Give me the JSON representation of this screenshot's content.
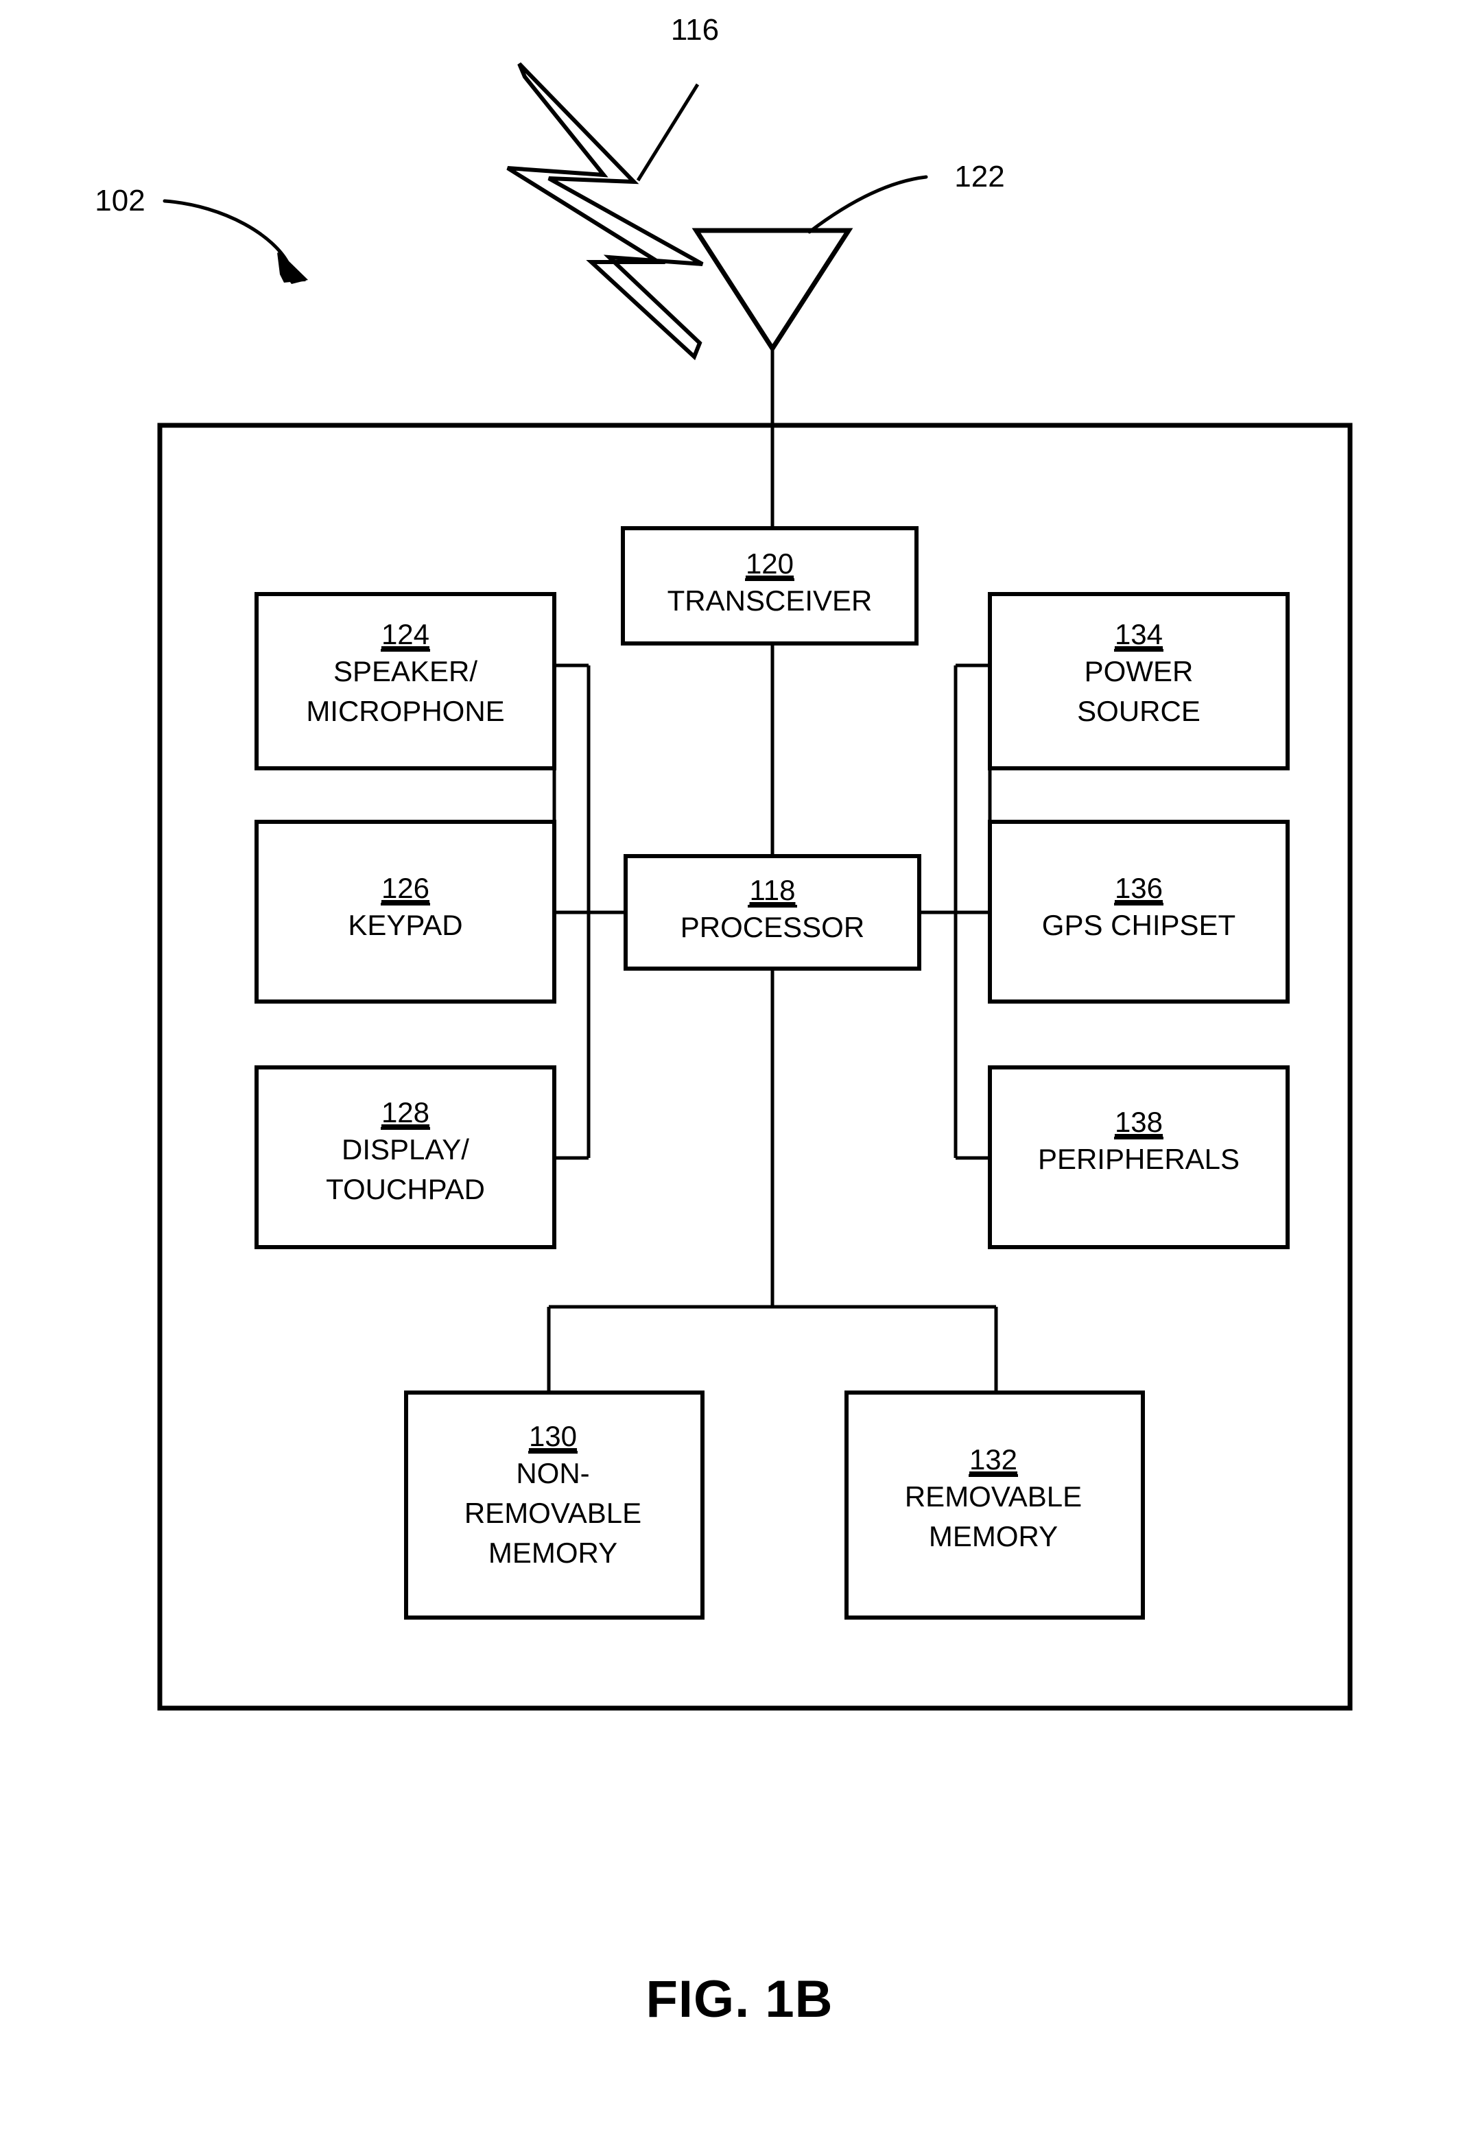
{
  "figure": {
    "caption": "FIG. 1B",
    "device_ref": "102",
    "air_interface_ref": "116",
    "antenna_ref": "122"
  },
  "blocks": {
    "transceiver": {
      "ref": "120",
      "lines": [
        "TRANSCEIVER"
      ]
    },
    "speaker_mic": {
      "ref": "124",
      "lines": [
        "SPEAKER/",
        "MICROPHONE"
      ]
    },
    "keypad": {
      "ref": "126",
      "lines": [
        "KEYPAD"
      ]
    },
    "display": {
      "ref": "128",
      "lines": [
        "DISPLAY/",
        "TOUCHPAD"
      ]
    },
    "processor": {
      "ref": "118",
      "lines": [
        "PROCESSOR"
      ]
    },
    "power_source": {
      "ref": "134",
      "lines": [
        "POWER",
        "SOURCE"
      ]
    },
    "gps_chipset": {
      "ref": "136",
      "lines": [
        "GPS CHIPSET"
      ]
    },
    "peripherals": {
      "ref": "138",
      "lines": [
        "PERIPHERALS"
      ]
    },
    "non_removable_memory": {
      "ref": "130",
      "lines": [
        "NON-",
        "REMOVABLE",
        "MEMORY"
      ]
    },
    "removable_memory": {
      "ref": "132",
      "lines": [
        "REMOVABLE",
        "MEMORY"
      ]
    }
  },
  "colors": {
    "ink": "#000000",
    "paper": "#ffffff"
  }
}
